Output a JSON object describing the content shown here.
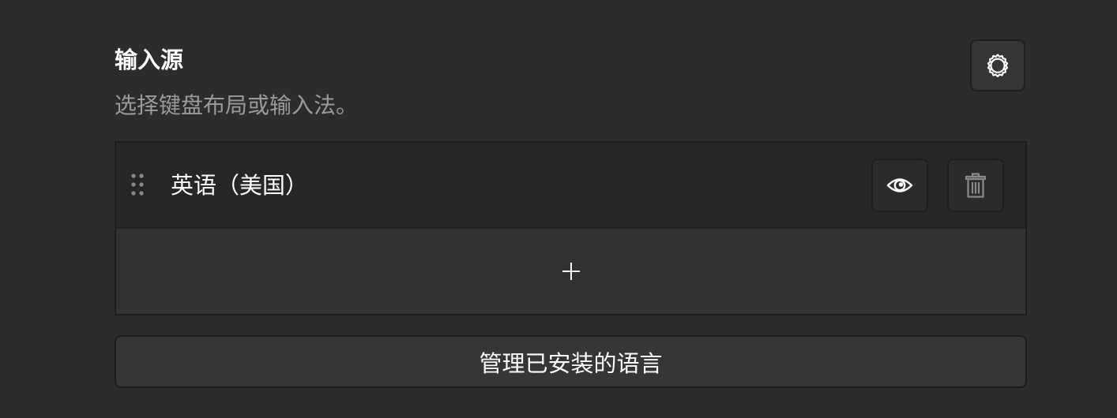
{
  "section": {
    "title": "输入源",
    "subtitle": "选择键盘布局或输入法。"
  },
  "input_sources": [
    {
      "label": "英语（美国）"
    }
  ],
  "actions": {
    "manage_languages_label": "管理已安装的语言"
  },
  "icons": {
    "settings": "gear-icon",
    "drag": "drag-handle-icon",
    "preview": "eye-icon",
    "remove": "trash-icon",
    "add": "plus-icon"
  },
  "colors": {
    "background": "#2c2c2c",
    "list_item_background": "#262626",
    "text_primary": "#ffffff",
    "text_secondary": "#9a9a9a"
  }
}
